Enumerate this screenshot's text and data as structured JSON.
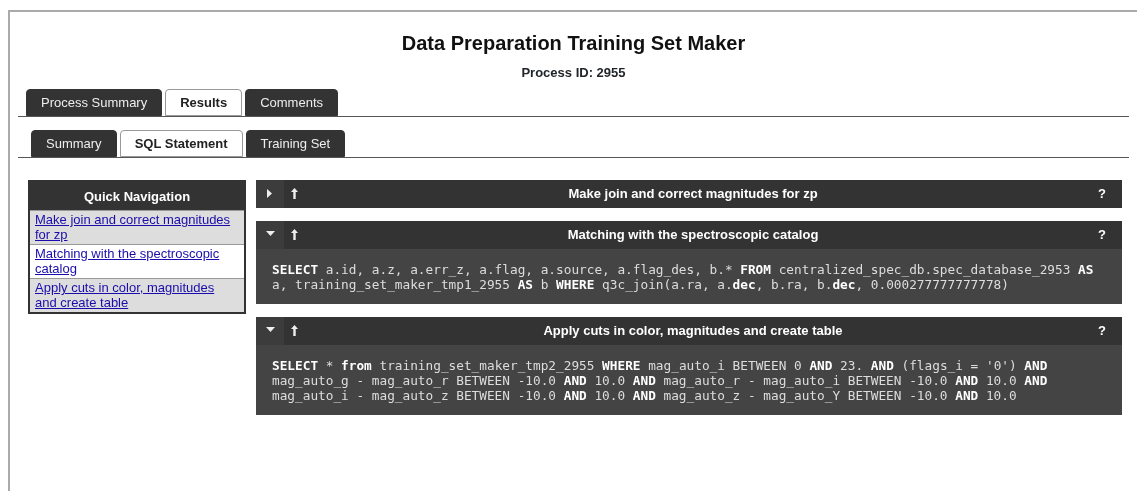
{
  "title": "Data Preparation Training Set Maker",
  "process_id": "Process ID: 2955",
  "tabs": [
    {
      "label": "Process Summary",
      "selected": false
    },
    {
      "label": "Results",
      "selected": true
    },
    {
      "label": "Comments",
      "selected": false
    }
  ],
  "subtabs": [
    {
      "label": "Summary",
      "selected": false
    },
    {
      "label": "SQL Statement",
      "selected": true
    },
    {
      "label": "Training Set",
      "selected": false
    }
  ],
  "quick_navigation": {
    "title": "Quick Navigation",
    "items": [
      "Make join and correct magnitudes for zp",
      "Matching with the spectroscopic catalog",
      "Apply cuts in color, magnitudes and create table"
    ]
  },
  "sections": [
    {
      "title": "Make join and correct magnitudes for zp",
      "expanded": false,
      "help": "?"
    },
    {
      "title": "Matching with the spectroscopic catalog",
      "expanded": true,
      "help": "?",
      "sql_lines": [
        "**SELECT** a.id, a.z, a.err_z, a.flag, a.source, a.flag_des, b.* **FROM** centralized_spec_db.spec_database_2953 **AS**",
        "a, training_set_maker_tmp1_2955 **AS** b **WHERE** q3c_join(a.ra, a.**dec**, b.ra, b.**dec**, 0.000277777777778)"
      ]
    },
    {
      "title": "Apply cuts in color, magnitudes and create table",
      "expanded": true,
      "help": "?",
      "sql_lines": [
        "**SELECT** * **from** training_set_maker_tmp2_2955 **WHERE** mag_auto_i BETWEEN 0 **AND** 23. **AND** (flags_i = '0') **AND**",
        "mag_auto_g - mag_auto_r BETWEEN -10.0 **AND** 10.0 **AND** mag_auto_r - mag_auto_i BETWEEN -10.0 **AND** 10.0 **AND**",
        "mag_auto_i - mag_auto_z BETWEEN -10.0 **AND** 10.0 **AND** mag_auto_z - mag_auto_Y BETWEEN -10.0 **AND** 10.0"
      ]
    }
  ]
}
